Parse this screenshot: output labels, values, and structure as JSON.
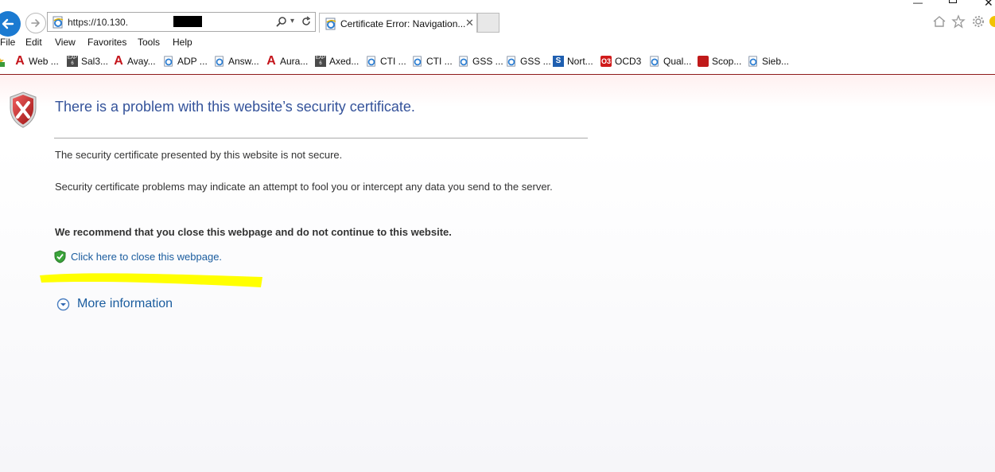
{
  "address_bar": {
    "url": "https://10.130."
  },
  "tab": {
    "title": "Certificate Error: Navigation..."
  },
  "menu": {
    "file": "File",
    "edit": "Edit",
    "view": "View",
    "favorites": "Favorites",
    "tools": "Tools",
    "help": "Help"
  },
  "favorites_bar": [
    "Web ...",
    "Sal3...",
    "Avay...",
    "ADP ...",
    "Answ...",
    "Aura...",
    "Axed...",
    "CTI ...",
    "CTI ...",
    "GSS ...",
    "GSS ...",
    "Nort...",
    "OCD3",
    "Qual...",
    "Scop...",
    "Sieb..."
  ],
  "icons": {
    "favorite_icons": [
      "a-icon",
      "eap-icon",
      "a-icon",
      "ie-page-icon",
      "ie-page-icon",
      "a-icon",
      "eap-icon",
      "ie-page-icon",
      "ie-page-icon",
      "ie-page-icon",
      "ie-page-icon",
      "s-icon",
      "o3-icon",
      "ie-page-icon",
      "scope-icon",
      "ie-page-icon"
    ]
  },
  "page": {
    "title": "There is a problem with this website’s security certificate.",
    "p1": "The security certificate presented by this website is not secure.",
    "p2": "Security certificate problems may indicate an attempt to fool you or intercept any data you send to the server.",
    "p3": "We recommend that you close this webpage and do not continue to this website.",
    "close_link": "Click here to close this webpage.",
    "more_info": "More information"
  },
  "colors": {
    "title": "#34529a",
    "link": "#1a5c9e",
    "highlight": "#ffff00",
    "error_shield": "#c62828"
  }
}
